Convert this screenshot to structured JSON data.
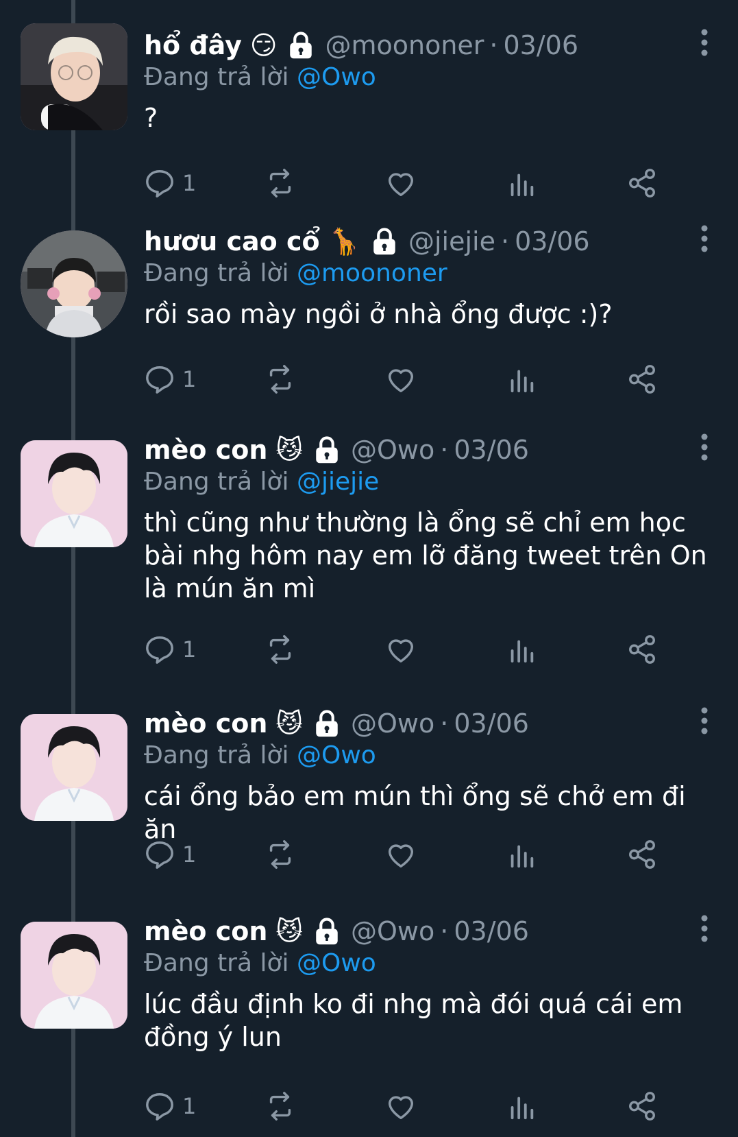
{
  "reply_prefix": "Đang trả lời",
  "dot": "·",
  "tweets": [
    {
      "name": "hổ đây",
      "emoji": "😏",
      "handle": "@moononer",
      "date": "03/06",
      "reply_to": "@Owo",
      "text": "?",
      "reply_count": "1",
      "avatar_icon": "avatar-photo-blond-person"
    },
    {
      "name": "hươu cao cổ",
      "emoji": "🦒",
      "handle": "@jiejie",
      "date": "03/06",
      "reply_to": "@moononer",
      "text": "rồi sao mày ngồi ở nhà ổng được :)?",
      "reply_count": "1",
      "avatar_icon": "avatar-photo-person-headset"
    },
    {
      "name": "mèo con",
      "emoji": "😼",
      "handle": "@Owo",
      "date": "03/06",
      "reply_to": "@jiejie",
      "text": "thì cũng như thường là ổng sẽ chỉ em học bài nhg hôm nay em lỡ đăng tweet trên On là mún ăn mì",
      "reply_count": "1",
      "avatar_icon": "avatar-photo-dark-hair-person"
    },
    {
      "name": "mèo con",
      "emoji": "😼",
      "handle": "@Owo",
      "date": "03/06",
      "reply_to": "@Owo",
      "text": "cái ổng bảo em mún thì ổng sẽ chở em đi ăn",
      "reply_count": "1",
      "avatar_icon": "avatar-photo-dark-hair-person"
    },
    {
      "name": "mèo con",
      "emoji": "😼",
      "handle": "@Owo",
      "date": "03/06",
      "reply_to": "@Owo",
      "text": "lúc đầu định ko đi nhg mà đói quá cái em đồng ý lun",
      "reply_count": "1",
      "avatar_icon": "avatar-photo-dark-hair-person"
    }
  ],
  "icons": {
    "reply": "reply-icon",
    "retweet": "retweet-icon",
    "like": "heart-icon",
    "views": "views-icon",
    "share": "share-icon",
    "lock": "lock-icon",
    "more": "more-vertical-icon"
  },
  "colors": {
    "background": "#15202b",
    "text": "#ffffff",
    "muted": "#8b98a5",
    "link": "#1d9bf0",
    "thread_line": "#3d4852"
  }
}
